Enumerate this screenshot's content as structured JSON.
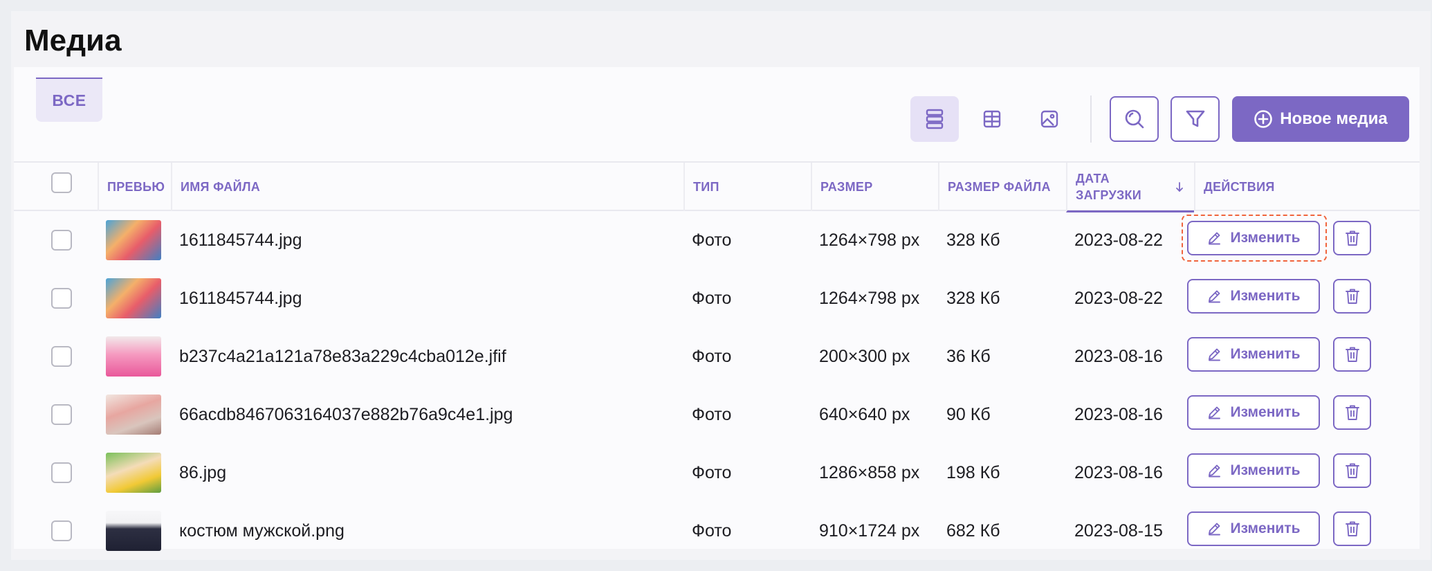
{
  "page": {
    "title": "Медиа"
  },
  "tabs": [
    {
      "label": "ВСЕ",
      "active": true
    }
  ],
  "toolbar": {
    "views": [
      {
        "name": "list-view",
        "icon": "list-icon",
        "active": true
      },
      {
        "name": "grid-view",
        "icon": "grid-icon",
        "active": false
      },
      {
        "name": "image-view",
        "icon": "image-icon",
        "active": false
      }
    ],
    "search_icon": "search-icon",
    "filter_icon": "filter-icon",
    "new_media_label": "Новое медиа",
    "new_media_icon": "plus-circle-icon"
  },
  "table": {
    "columns": {
      "preview": "ПРЕВЬЮ",
      "filename": "ИМЯ ФАЙЛА",
      "type": "ТИП",
      "size": "РАЗМЕР",
      "file_size": "РАЗМЕР ФАЙЛА",
      "upload_date_line1": "ДАТА",
      "upload_date_line2": "ЗАГРУЗКИ",
      "actions": "ДЕЙСТВИЯ"
    },
    "sort": {
      "column": "upload_date",
      "direction": "desc",
      "icon": "arrow-down-icon"
    },
    "edit_label": "Изменить",
    "edit_icon": "pencil-icon",
    "delete_icon": "trash-icon",
    "rows": [
      {
        "filename": "1611845744.jpg",
        "type": "Фото",
        "size": "1264×798 px",
        "file_size": "328 Кб",
        "date": "2023-08-22",
        "focused": true
      },
      {
        "filename": "1611845744.jpg",
        "type": "Фото",
        "size": "1264×798 px",
        "file_size": "328 Кб",
        "date": "2023-08-22"
      },
      {
        "filename": "b237c4a21a121a78e83a229c4cba012e.jfif",
        "type": "Фото",
        "size": "200×300 px",
        "file_size": "36 Кб",
        "date": "2023-08-16"
      },
      {
        "filename": "66acdb8467063164037e882b76a9c4e1.jpg",
        "type": "Фото",
        "size": "640×640 px",
        "file_size": "90 Кб",
        "date": "2023-08-16"
      },
      {
        "filename": "86.jpg",
        "type": "Фото",
        "size": "1286×858 px",
        "file_size": "198 Кб",
        "date": "2023-08-16"
      },
      {
        "filename": "костюм мужской.png",
        "type": "Фото",
        "size": "910×1724 px",
        "file_size": "682 Кб",
        "date": "2023-08-15"
      }
    ]
  },
  "colors": {
    "accent": "#7c68c4",
    "accent_light": "#e6e1f6",
    "focus": "#f0643c",
    "background": "#eceef2"
  }
}
